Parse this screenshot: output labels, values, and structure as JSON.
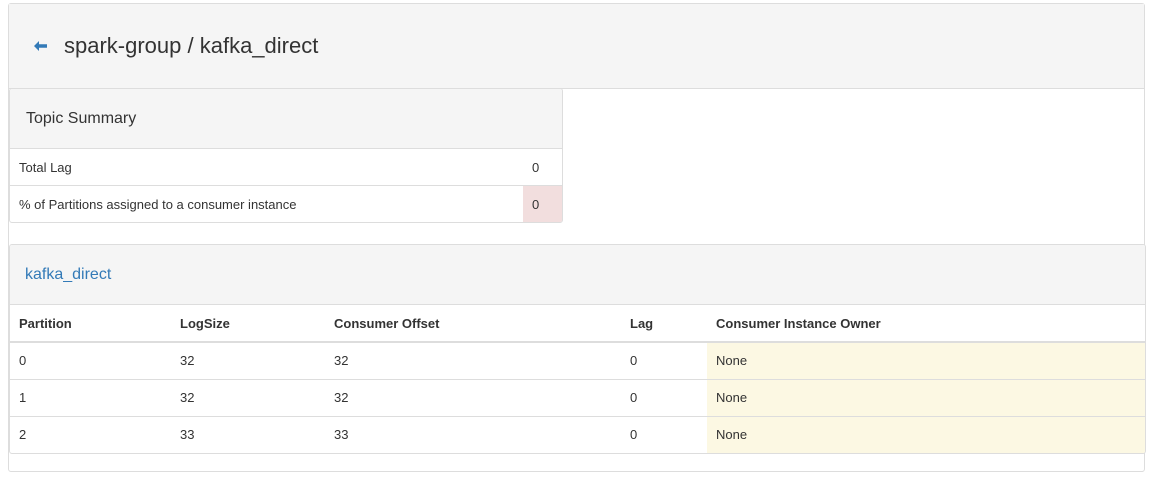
{
  "header": {
    "title": "spark-group / kafka_direct",
    "back_icon": "arrow-left-icon",
    "accent_color": "#337ab7"
  },
  "summary": {
    "heading": "Topic Summary",
    "rows": [
      {
        "label": "Total Lag",
        "value": "0",
        "status": "normal"
      },
      {
        "label": "% of Partitions assigned to a consumer instance",
        "value": "0",
        "status": "danger"
      }
    ],
    "danger_color": "#f2dede"
  },
  "topic": {
    "name": "kafka_direct",
    "columns": [
      "Partition",
      "LogSize",
      "Consumer Offset",
      "Lag",
      "Consumer Instance Owner"
    ],
    "rows": [
      {
        "partition": "0",
        "logsize": "32",
        "offset": "32",
        "lag": "0",
        "owner": "None"
      },
      {
        "partition": "1",
        "logsize": "32",
        "offset": "32",
        "lag": "0",
        "owner": "None"
      },
      {
        "partition": "2",
        "logsize": "33",
        "offset": "33",
        "lag": "0",
        "owner": "None"
      }
    ],
    "warning_color": "#fcf8e3"
  }
}
